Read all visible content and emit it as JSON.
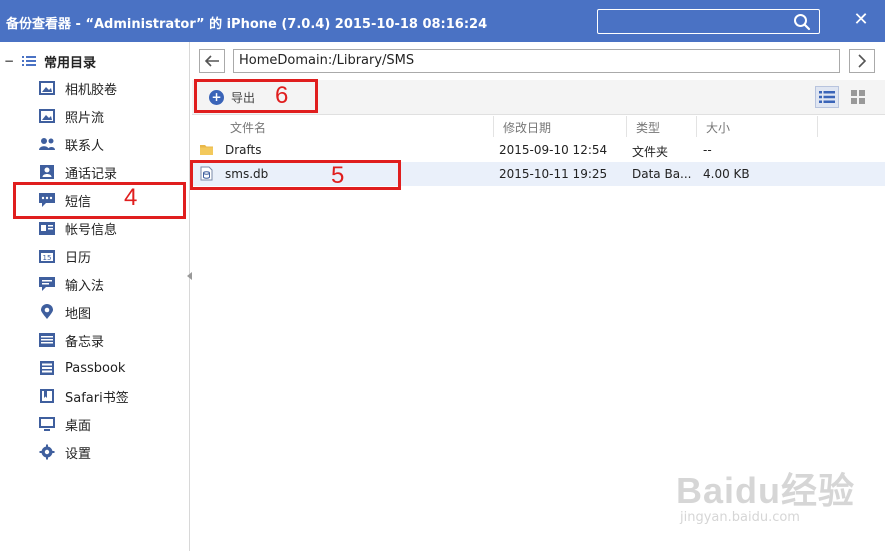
{
  "titlebar": {
    "title": "备份查看器 - “Administrator” 的 iPhone (7.0.4) 2015-10-18 08:16:24",
    "close": "✕"
  },
  "sidebar": {
    "root_label": "常用目录",
    "collapse_glyph": "−",
    "items": [
      {
        "label": "相机胶卷",
        "icon": "photo-icon"
      },
      {
        "label": "照片流",
        "icon": "photostream-icon"
      },
      {
        "label": "联系人",
        "icon": "contacts-icon"
      },
      {
        "label": "通话记录",
        "icon": "call-log-icon"
      },
      {
        "label": "短信",
        "icon": "sms-icon"
      },
      {
        "label": "帐号信息",
        "icon": "account-icon"
      },
      {
        "label": "日历",
        "icon": "calendar-icon"
      },
      {
        "label": "输入法",
        "icon": "input-method-icon"
      },
      {
        "label": "地图",
        "icon": "map-pin-icon"
      },
      {
        "label": "备忘录",
        "icon": "notes-icon"
      },
      {
        "label": "Passbook",
        "icon": "passbook-icon"
      },
      {
        "label": "Safari书签",
        "icon": "bookmark-icon"
      },
      {
        "label": "桌面",
        "icon": "desktop-icon"
      },
      {
        "label": "设置",
        "icon": "settings-gear-icon"
      }
    ]
  },
  "nav": {
    "path": "HomeDomain:/Library/SMS"
  },
  "toolbar": {
    "export_label": "导出"
  },
  "table": {
    "columns": [
      "文件名",
      "修改日期",
      "类型",
      "大小"
    ],
    "rows": [
      {
        "name": "Drafts",
        "modified": "2015-09-10 12:54",
        "type": "文件夹",
        "size": "--",
        "icon": "folder-icon"
      },
      {
        "name": "sms.db",
        "modified": "2015-10-11 19:25",
        "type": "Data Ba...",
        "size": "4.00 KB",
        "icon": "database-file-icon"
      }
    ]
  },
  "annotations": {
    "n4": "4",
    "n5": "5",
    "n6": "6"
  },
  "watermark": {
    "main": "Baidu经验",
    "sub": "jingyan.baidu.com"
  },
  "colors": {
    "titlebar": "#4a72c4",
    "annotation": "#e01e1e",
    "accent": "#3a64b8"
  }
}
